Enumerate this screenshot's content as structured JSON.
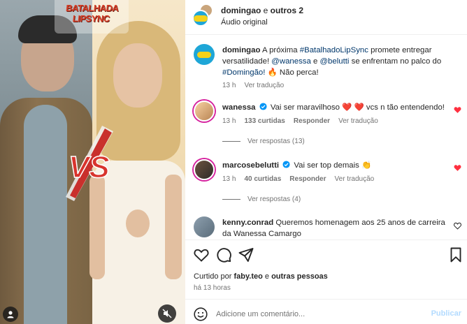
{
  "media": {
    "logo_line1": "BATALHADA",
    "logo_line2": "LIPSYNC",
    "vs_text": "VS"
  },
  "header": {
    "username": "domingao",
    "connector": " e ",
    "others": "outros 2",
    "audio": "Áudio original"
  },
  "caption": {
    "username": "domingao",
    "segments": [
      {
        "text": " A próxima ",
        "tag": false
      },
      {
        "text": "#BatalhadoLipSync",
        "tag": true
      },
      {
        "text": " promete entregar versatilidade! ",
        "tag": false
      },
      {
        "text": "@wanessa",
        "tag": true
      },
      {
        "text": " e ",
        "tag": false
      },
      {
        "text": "@belutti",
        "tag": true
      },
      {
        "text": " se enfrentam no palco do ",
        "tag": false
      },
      {
        "text": "#Domingão!",
        "tag": true
      },
      {
        "text": " 🔥 Não perca!",
        "tag": false
      }
    ],
    "time": "13 h",
    "translate": "Ver tradução"
  },
  "comments": [
    {
      "username": "wanessa",
      "text": "Vai ser maravilhoso ❤️ ❤️ vcs n tão entendendo!",
      "time": "13 h",
      "likes": "133 curtidas",
      "reply": "Responder",
      "translate": "Ver tradução",
      "replies": "Ver respostas (13)"
    },
    {
      "username": "marcosebelutti",
      "text": "Vai ser top demais 👏",
      "time": "13 h",
      "likes": "40 curtidas",
      "reply": "Responder",
      "translate": "Ver tradução",
      "replies": "Ver respostas (4)"
    },
    {
      "username": "kenny.conrad",
      "text": " Queremos homenagem aos 25 anos de carreira da Wanessa Camargo"
    }
  ],
  "likes": {
    "prefix": "Curtido por ",
    "user": "faby.teo",
    "connector": " e ",
    "others": "outras pessoas"
  },
  "timestamp": "há 13 horas",
  "add_comment": {
    "placeholder": "Adicione um comentário...",
    "publish": "Publicar"
  },
  "colors": {
    "link": "#00376b",
    "heart": "#ff3040",
    "muted": "#737373",
    "publish_disabled": "#b3dbff",
    "brand": "#1ea6d7"
  }
}
